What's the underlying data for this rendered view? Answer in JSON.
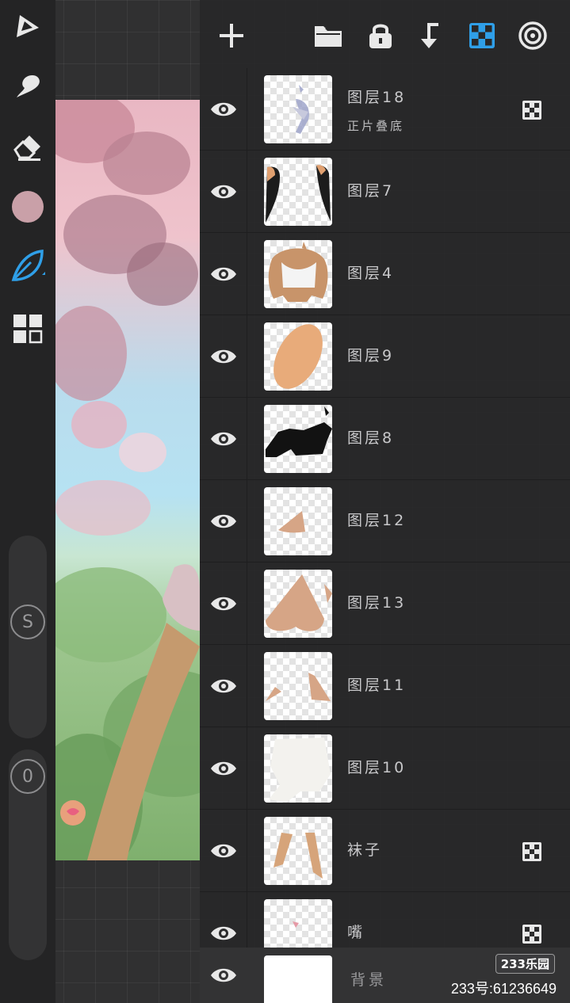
{
  "toolbar": {
    "tools": [
      {
        "name": "paint-icon"
      },
      {
        "name": "smudge-icon"
      },
      {
        "name": "eraser-icon"
      },
      {
        "name": "color-swatch",
        "color": "#c9a0a8"
      },
      {
        "name": "leaf-brush-icon",
        "color": "#2f9fe8"
      },
      {
        "name": "layers-grid-icon"
      }
    ],
    "size_label": "S",
    "opacity_label": "0"
  },
  "header": {
    "buttons": [
      "add-icon",
      "folder-icon",
      "lock-icon",
      "merge-down-icon",
      "alpha-lock-icon",
      "settings-icon"
    ],
    "accent": "#2f9fe8"
  },
  "layers": [
    {
      "name": "图层18",
      "sub": "正片叠底",
      "has_blend_icon": true
    },
    {
      "name": "图层7",
      "sub": "",
      "has_blend_icon": false
    },
    {
      "name": "图层4",
      "sub": "",
      "has_blend_icon": false
    },
    {
      "name": "图层9",
      "sub": "",
      "has_blend_icon": false
    },
    {
      "name": "图层8",
      "sub": "",
      "has_blend_icon": false
    },
    {
      "name": "图层12",
      "sub": "",
      "has_blend_icon": false
    },
    {
      "name": "图层13",
      "sub": "",
      "has_blend_icon": false
    },
    {
      "name": "图层11",
      "sub": "",
      "has_blend_icon": false
    },
    {
      "name": "图层10",
      "sub": "",
      "has_blend_icon": false
    },
    {
      "name": "袜子",
      "sub": "",
      "has_blend_icon": true
    },
    {
      "name": "嘴",
      "sub": "",
      "has_blend_icon": true
    }
  ],
  "background_layer": {
    "name": "背景"
  },
  "watermark": {
    "logo": "233乐园",
    "id_text": "233号:61236649"
  }
}
